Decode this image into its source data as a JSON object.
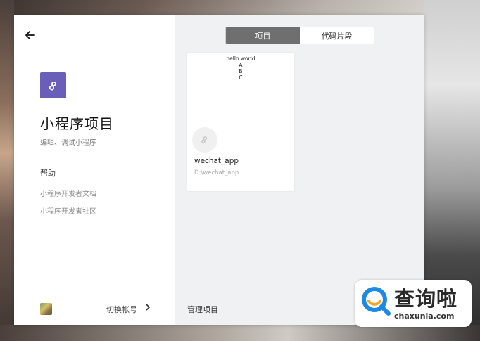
{
  "sidebar": {
    "back_icon": "arrow-left-icon",
    "app_logo_icon": "mini-program-icon",
    "title": "小程序项目",
    "subtitle": "编辑、调试小程序",
    "help": {
      "heading": "帮助",
      "links": [
        "小程序开发者文档",
        "小程序开发者社区"
      ]
    },
    "switch_account": "切换帐号"
  },
  "tabs": [
    {
      "label": "项目",
      "active": true
    },
    {
      "label": "代码片段",
      "active": false
    }
  ],
  "project_card": {
    "preview_lines": [
      "hello world",
      "A",
      "B",
      "C"
    ],
    "name": "wechat_app",
    "path": "D:\\wechat_app"
  },
  "manage_label": "管理项目",
  "watermark": {
    "text_cn": "查询啦",
    "text_en": "chaxunla.com"
  },
  "colors": {
    "logo_bg": "#6a5fb8",
    "active_tab": "#6f6f6f",
    "main_bg": "#f0f1f3",
    "watermark_blue": "#1e88e5",
    "watermark_orange": "#f5a623"
  }
}
